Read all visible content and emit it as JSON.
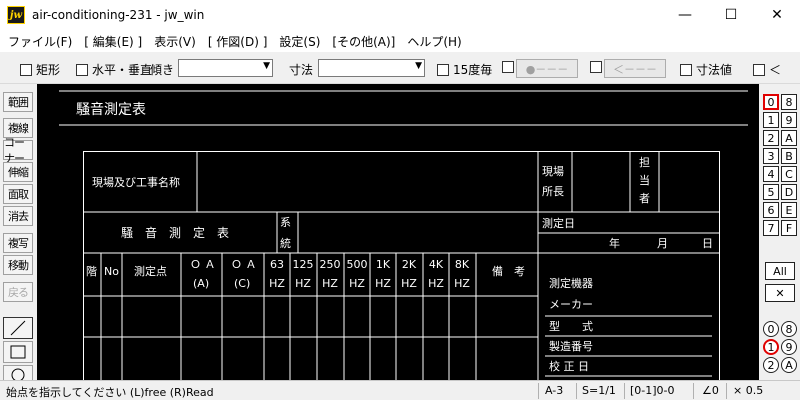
{
  "window": {
    "title": "air-conditioning-231 - jw_win",
    "icon_label": "jw",
    "min": "—",
    "max": "☐",
    "close": "✕"
  },
  "menu": [
    "ファイル(F)",
    "[ 編集(E) ]",
    "表示(V)",
    "[ 作図(D) ]",
    "設定(S)",
    "[その他(A)]",
    "ヘルプ(H)"
  ],
  "toolbar": {
    "rect": "矩形",
    "hv": "水平・垂直",
    "tilt": "傾き",
    "dim": "寸法",
    "deg15": "15度毎",
    "circle": "●－－－",
    "arrow": "＜－－－",
    "dimval": "寸法値",
    "lt": "＜"
  },
  "leftbar": [
    "範囲",
    "複線",
    "コーナー",
    "伸縮",
    "面取",
    "消去",
    "複写",
    "移動",
    "戻る"
  ],
  "drawing": {
    "heading": "騒音測定表",
    "site_label": "現場及び工事名称",
    "genba1": "現場",
    "genba2": "所長",
    "tanto": [
      "担",
      "当",
      "者"
    ],
    "table_title": "騒　音　測　定　表",
    "kei": "系",
    "tou": "統",
    "date_label": "測定日",
    "year": "年",
    "month": "月",
    "day": "日",
    "kai": "階",
    "no": "No",
    "point": "測定点",
    "oa1": "Ｏ Ａ",
    "oa1b": "(A)",
    "oa2": "Ｏ Ａ",
    "oa2b": "(C)",
    "freqs": [
      "63",
      "125",
      "250",
      "500",
      "1K",
      "2K",
      "4K",
      "8K"
    ],
    "hz": "HZ",
    "biko": "備　考",
    "device": "測定機器",
    "maker": "メーカー",
    "model": "型　　式",
    "serial": "製造番号",
    "calib": "校 正 日"
  },
  "rightbar": {
    "left": [
      "0",
      "1",
      "2",
      "3",
      "4",
      "5",
      "6",
      "7"
    ],
    "right": [
      "8",
      "9",
      "A",
      "B",
      "C",
      "D",
      "E",
      "F"
    ],
    "all": "All",
    "x": "✕",
    "lower_left": [
      "0",
      "1",
      "2"
    ],
    "lower_right": [
      "8",
      "9",
      "A"
    ]
  },
  "status": {
    "message": "始点を指示してください (L)free (R)Read",
    "paper": "A-3",
    "scale": "S=1/1",
    "layer": "[0-1]0-0",
    "angle": "∠0",
    "zoom": "× 0.5"
  }
}
